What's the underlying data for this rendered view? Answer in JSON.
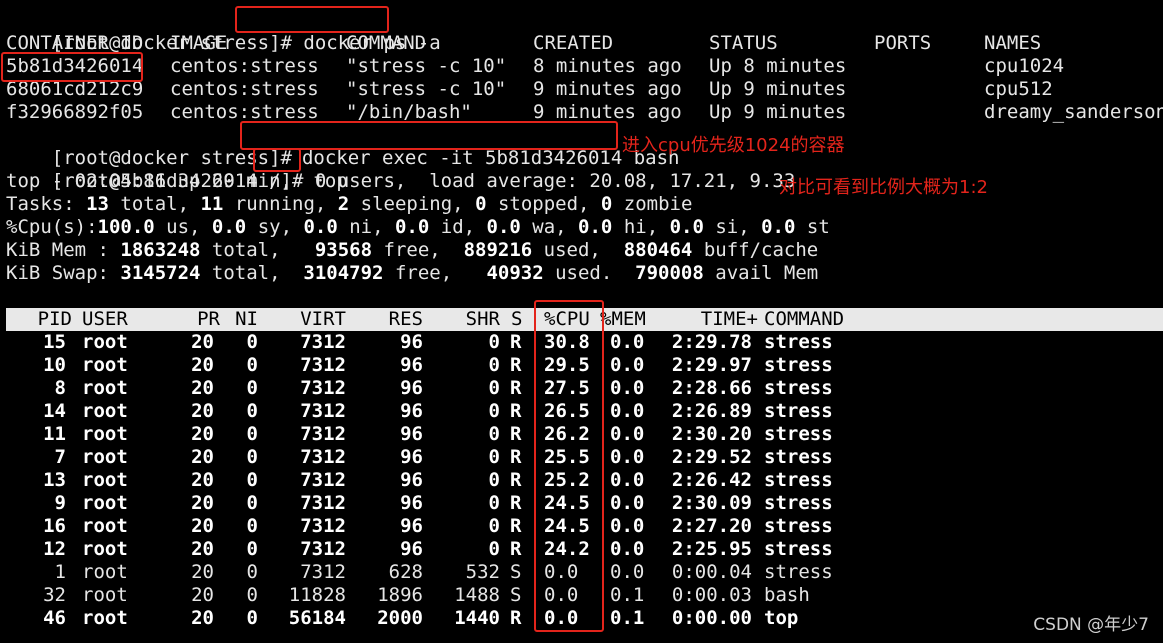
{
  "prompts": {
    "p1": "[root@docker stress]#",
    "cmd1": " docker ps -a",
    "p2": "[root@docker stress]#",
    "cmd2": "docker exec -it 5b81d3426014 bash",
    "p3": "[root@5b81d3426014 /]#",
    "cmd3": "top"
  },
  "ps_table": {
    "headers": [
      "CONTAINER ID",
      "IMAGE",
      "COMMAND",
      "CREATED",
      "STATUS",
      "PORTS",
      "NAMES"
    ],
    "rows": [
      {
        "id": "5b81d3426014",
        "image": "centos:stress",
        "command": "\"stress -c 10\"",
        "created": "8 minutes ago",
        "status": "Up 8 minutes",
        "ports": "",
        "name": "cpu1024"
      },
      {
        "id": "68061cd212c9",
        "image": "centos:stress",
        "command": "\"stress -c 10\"",
        "created": "9 minutes ago",
        "status": "Up 9 minutes",
        "ports": "",
        "name": "cpu512"
      },
      {
        "id": "f32966892f05",
        "image": "centos:stress",
        "command": "\"/bin/bash\"",
        "created": "9 minutes ago",
        "status": "Up 9 minutes",
        "ports": "",
        "name": "dreamy_sanderson"
      }
    ]
  },
  "top_summary": {
    "line1": "top - 02:04:16 up 29 min,  0 users,  load average: 20.08, 17.21, 9.33",
    "line2_parts": [
      "Tasks: ",
      "13",
      " total, ",
      "11",
      " running, ",
      "2",
      " sleeping, ",
      "0",
      " stopped, ",
      "0",
      " zombie"
    ],
    "line3_parts": [
      "%Cpu(s):",
      "100.0",
      " us, ",
      "0.0",
      " sy, ",
      "0.0",
      " ni, ",
      "0.0",
      " id, ",
      "0.0",
      " wa, ",
      "0.0",
      " hi, ",
      "0.0",
      " si, ",
      "0.0",
      " st"
    ],
    "line4_parts": [
      "KiB Mem : ",
      "1863248",
      " total,   ",
      "93568",
      " free,  ",
      "889216",
      " used,  ",
      "880464",
      " buff/cache"
    ],
    "line5_parts": [
      "KiB Swap: ",
      "3145724",
      " total,  ",
      "3104792",
      " free,   ",
      "40932",
      " used.  ",
      "790008",
      " avail Mem"
    ]
  },
  "proc_headers": {
    "pid": "PID",
    "user": "USER",
    "pr": "PR",
    "ni": "NI",
    "virt": "VIRT",
    "res": "RES",
    "shr": "SHR",
    "s": "S",
    "cpu": "%CPU",
    "mem": "%MEM",
    "time": "TIME+",
    "command": "COMMAND"
  },
  "processes": [
    {
      "pid": "15",
      "user": "root",
      "pr": "20",
      "ni": "0",
      "virt": "7312",
      "res": "96",
      "shr": "0",
      "s": "R",
      "cpu": "30.8",
      "mem": "0.0",
      "time": "2:29.78",
      "command": "stress",
      "bold": true
    },
    {
      "pid": "10",
      "user": "root",
      "pr": "20",
      "ni": "0",
      "virt": "7312",
      "res": "96",
      "shr": "0",
      "s": "R",
      "cpu": "29.5",
      "mem": "0.0",
      "time": "2:29.97",
      "command": "stress",
      "bold": true
    },
    {
      "pid": "8",
      "user": "root",
      "pr": "20",
      "ni": "0",
      "virt": "7312",
      "res": "96",
      "shr": "0",
      "s": "R",
      "cpu": "27.5",
      "mem": "0.0",
      "time": "2:28.66",
      "command": "stress",
      "bold": true
    },
    {
      "pid": "14",
      "user": "root",
      "pr": "20",
      "ni": "0",
      "virt": "7312",
      "res": "96",
      "shr": "0",
      "s": "R",
      "cpu": "26.5",
      "mem": "0.0",
      "time": "2:26.89",
      "command": "stress",
      "bold": true
    },
    {
      "pid": "11",
      "user": "root",
      "pr": "20",
      "ni": "0",
      "virt": "7312",
      "res": "96",
      "shr": "0",
      "s": "R",
      "cpu": "26.2",
      "mem": "0.0",
      "time": "2:30.20",
      "command": "stress",
      "bold": true
    },
    {
      "pid": "7",
      "user": "root",
      "pr": "20",
      "ni": "0",
      "virt": "7312",
      "res": "96",
      "shr": "0",
      "s": "R",
      "cpu": "25.5",
      "mem": "0.0",
      "time": "2:29.52",
      "command": "stress",
      "bold": true
    },
    {
      "pid": "13",
      "user": "root",
      "pr": "20",
      "ni": "0",
      "virt": "7312",
      "res": "96",
      "shr": "0",
      "s": "R",
      "cpu": "25.2",
      "mem": "0.0",
      "time": "2:26.42",
      "command": "stress",
      "bold": true
    },
    {
      "pid": "9",
      "user": "root",
      "pr": "20",
      "ni": "0",
      "virt": "7312",
      "res": "96",
      "shr": "0",
      "s": "R",
      "cpu": "24.5",
      "mem": "0.0",
      "time": "2:30.09",
      "command": "stress",
      "bold": true
    },
    {
      "pid": "16",
      "user": "root",
      "pr": "20",
      "ni": "0",
      "virt": "7312",
      "res": "96",
      "shr": "0",
      "s": "R",
      "cpu": "24.5",
      "mem": "0.0",
      "time": "2:27.20",
      "command": "stress",
      "bold": true
    },
    {
      "pid": "12",
      "user": "root",
      "pr": "20",
      "ni": "0",
      "virt": "7312",
      "res": "96",
      "shr": "0",
      "s": "R",
      "cpu": "24.2",
      "mem": "0.0",
      "time": "2:25.95",
      "command": "stress",
      "bold": true
    },
    {
      "pid": "1",
      "user": "root",
      "pr": "20",
      "ni": "0",
      "virt": "7312",
      "res": "628",
      "shr": "532",
      "s": "S",
      "cpu": "0.0",
      "mem": "0.0",
      "time": "0:00.04",
      "command": "stress",
      "bold": false
    },
    {
      "pid": "32",
      "user": "root",
      "pr": "20",
      "ni": "0",
      "virt": "11828",
      "res": "1896",
      "shr": "1488",
      "s": "S",
      "cpu": "0.0",
      "mem": "0.1",
      "time": "0:00.03",
      "command": "bash",
      "bold": false
    },
    {
      "pid": "46",
      "user": "root",
      "pr": "20",
      "ni": "0",
      "virt": "56184",
      "res": "2000",
      "shr": "1440",
      "s": "R",
      "cpu": "0.0",
      "mem": "0.1",
      "time": "0:00.00",
      "command": "top",
      "bold": true
    }
  ],
  "annotations": {
    "exec_note": "进入cpu优先级1024的容器",
    "ratio_note": "对比可看到比例大概为1:2"
  },
  "watermark": "CSDN @年少7",
  "colors": {
    "background": "#000000",
    "text": "#e6e6e6",
    "highlight": "#e3241b",
    "header_bar": "#e8e8e8"
  }
}
